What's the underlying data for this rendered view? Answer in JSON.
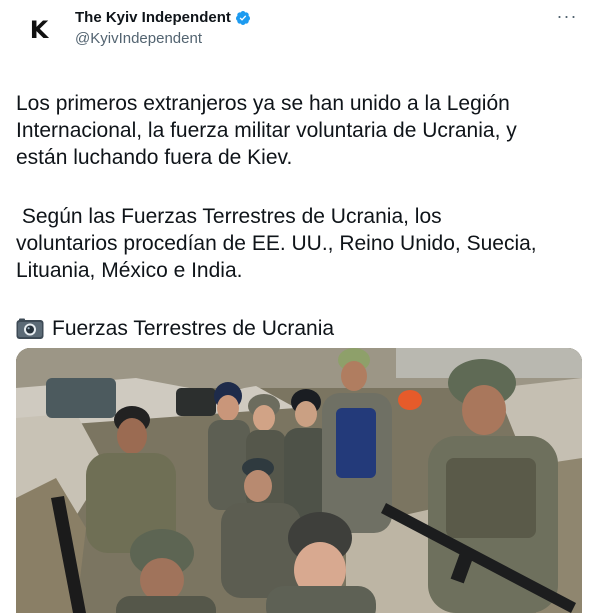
{
  "author": {
    "avatar_letter": "K",
    "display_name": "The Kyiv Independent",
    "handle": "@KyivIndependent",
    "verified": true
  },
  "header": {
    "more_label": "···"
  },
  "tweet": {
    "paragraph_1": "Los primeros extranjeros ya se han unido a la Legión\nInternacional, la fuerza militar voluntaria de Ucrania, y\nestán luchando fuera de Kiev.",
    "paragraph_2": " Según las Fuerzas Terrestres de Ucrania, los\nvoluntarios procedían de EE. UU., Reino Unido, Suecia,\nLituania, México e India.",
    "credit": "Fuerzas Terrestres de Ucrania"
  },
  "icons": {
    "camera": "camera-icon",
    "verified": "verified-badge-icon",
    "more": "more-options-icon"
  },
  "colors": {
    "verified_blue": "#1d9bf0",
    "handle_gray": "#536471",
    "text": "#0f1419"
  }
}
